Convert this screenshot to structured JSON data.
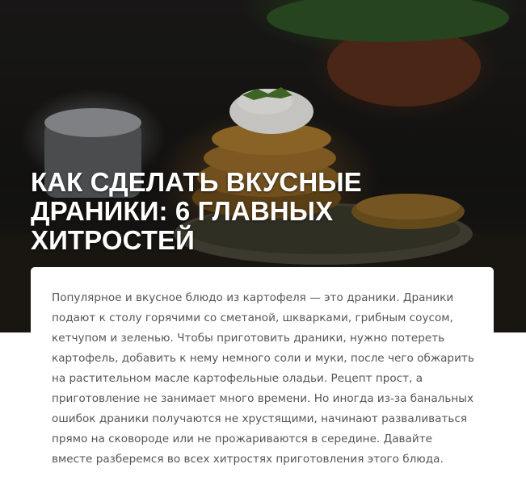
{
  "article": {
    "title": "КАК СДЕЛАТЬ ВКУСНЫЕ ДРАНИКИ: 6 ГЛАВНЫХ ХИТРОСТЕЙ",
    "intro": "Популярное и вкусное блюдо из картофеля — это драники. Драники подают к столу горячими со сметаной, шкварками, грибным соусом, кетчупом и зеленью. Чтобы приготовить драники, нужно потереть картофель, добавить к нему немного соли и муки, после чего обжарить на растительном масле картофельные оладьи. Рецепт прост, а приготовление не занимает много времени. Но иногда из-за банальных ошибок драники получаются не хрустящими, начинают разваливаться прямо на сковороде или не прожариваются в середине. Давайте вместе разберемся во всех хитростях приготовления этого блюда."
  },
  "hero_image": {
    "subject": "stack of potato pancakes with sour cream and herbs"
  }
}
